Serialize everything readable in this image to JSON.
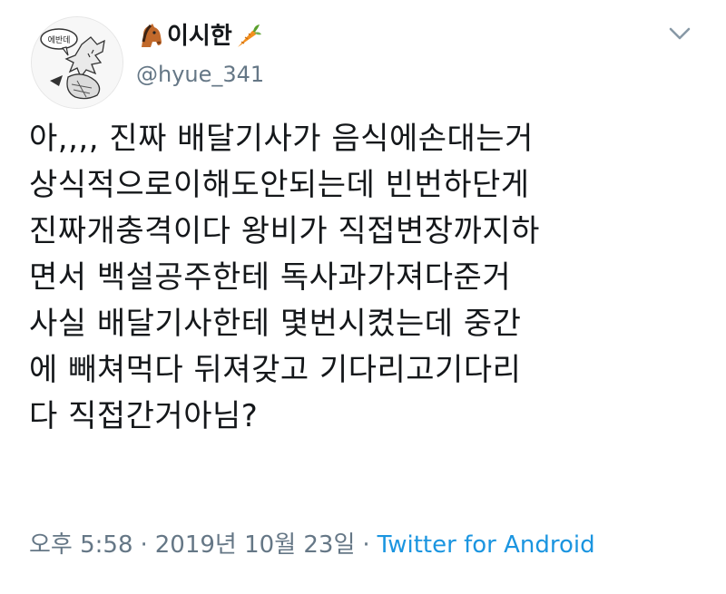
{
  "user": {
    "avatar_text": "에반데",
    "display_name": "이시한",
    "handle": "@hyue_341",
    "name_prefix_icon": "horse-icon",
    "name_suffix_icon": "carrot-icon"
  },
  "tweet": {
    "lines": [
      "아,,,, 진짜 배달기사가 음식에손대는거",
      "상식적으로이해도안되는데 빈번하단게",
      "진짜개충격이다 왕비가 직접변장까지하",
      "면서 백설공주한테 독사과가져다준거",
      "사실 배달기사한테 몇번시켰는데 중간",
      "에 빼쳐먹다 뒤져갖고 기다리고기다리",
      "다 직접간거아님?"
    ],
    "time": "오후 5:58",
    "date": "2019년 10월 23일",
    "separator": "·",
    "source": "Twitter for Android"
  },
  "controls": {
    "more_icon": "chevron-down-icon"
  },
  "colors": {
    "text": "#14171a",
    "muted": "#657786",
    "link": "#1b95e0"
  }
}
